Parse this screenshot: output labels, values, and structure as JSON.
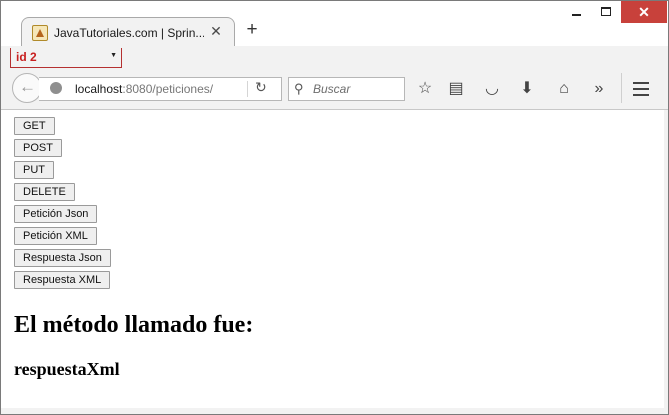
{
  "browser": {
    "tab_title": "JavaTutoriales.com | Sprin...",
    "close_tab_glyph": "✕",
    "new_tab_glyph": "+",
    "close_window_glyph": "✕",
    "tab_group": "id 2",
    "dropdown_glyph": "▼",
    "url_host": "localhost",
    "url_rest": ":8080/peticiones/",
    "reload_glyph": "↻",
    "search_placeholder": "Buscar",
    "icons": [
      "back-arrow-icon",
      "globe-icon",
      "reload-icon",
      "search-icon",
      "bookmark-star-icon",
      "reading-list-icon",
      "pocket-icon",
      "download-icon",
      "home-icon",
      "overflow-icon",
      "hamburger-menu-icon"
    ],
    "toolbar_glyphs": {
      "back": "←",
      "star": "☆",
      "reading": "▤",
      "pocket": "◡",
      "download": "⬇",
      "home": "⌂",
      "overflow": "»",
      "search": "⚲"
    },
    "close_color": "#c8413b",
    "group_color": "#c81f1f"
  },
  "page": {
    "buttons": [
      "GET",
      "POST",
      "PUT",
      "DELETE",
      "Petición Json",
      "Petición XML",
      "Respuesta Json",
      "Respuesta XML"
    ],
    "heading": "El método llamado fue:",
    "result": "respuestaXml"
  }
}
